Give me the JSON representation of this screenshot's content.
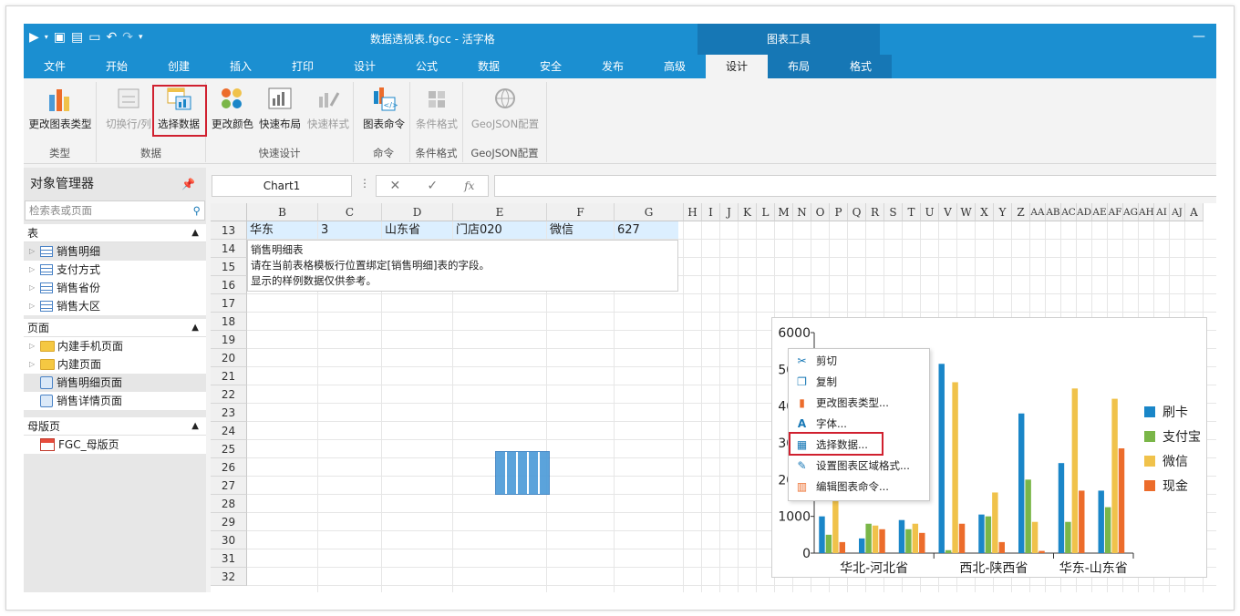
{
  "window": {
    "title": "数据透视表.fgcc - 活字格",
    "context_group": "图表工具"
  },
  "tabs": [
    "文件",
    "开始",
    "创建",
    "插入",
    "打印",
    "设计",
    "公式",
    "数据",
    "安全",
    "发布",
    "高级",
    "设计",
    "布局",
    "格式"
  ],
  "ribbon": {
    "groups": [
      {
        "label": "类型",
        "buttons": [
          "更改图表类型"
        ]
      },
      {
        "label": "数据",
        "buttons": [
          "切换行/列",
          "选择数据"
        ]
      },
      {
        "label": "快速设计",
        "buttons": [
          "更改颜色",
          "快速布局",
          "快速样式"
        ]
      },
      {
        "label": "命令",
        "buttons": [
          "图表命令"
        ]
      },
      {
        "label": "条件格式",
        "buttons": [
          "条件格式"
        ]
      },
      {
        "label": "GeoJSON配置",
        "buttons": [
          "GeoJSON配置"
        ]
      }
    ]
  },
  "panel": {
    "title": "对象管理器",
    "search_placeholder": "检索表或页面",
    "sections": [
      {
        "title": "表",
        "items": [
          "销售明细",
          "支付方式",
          "销售省份",
          "销售大区"
        ]
      },
      {
        "title": "页面",
        "items": [
          "内建手机页面",
          "内建页面",
          "销售明细页面",
          "销售详情页面"
        ]
      },
      {
        "title": "母版页",
        "items": [
          "FGC_母版页"
        ]
      }
    ]
  },
  "formula_bar": {
    "name_box": "Chart1",
    "fx": "fx"
  },
  "sheet": {
    "columns": [
      "B",
      "C",
      "D",
      "E",
      "F",
      "G",
      "H",
      "I",
      "J",
      "K",
      "L",
      "M",
      "N",
      "O",
      "P",
      "Q",
      "R",
      "S",
      "T",
      "U",
      "V",
      "W",
      "X",
      "Y",
      "Z",
      "AA",
      "AB",
      "AC",
      "AD",
      "AE",
      "AF",
      "AG",
      "AH",
      "AI",
      "AJ",
      "A"
    ],
    "rows": [
      "13",
      "14",
      "15",
      "16",
      "17",
      "18",
      "19",
      "20",
      "21",
      "22",
      "23",
      "24",
      "25",
      "26",
      "27",
      "28",
      "29",
      "30",
      "31",
      "32"
    ],
    "row13": [
      "华东",
      "3",
      "山东省",
      "门店020",
      "微信",
      "627"
    ],
    "notes": [
      "销售明细表",
      "请在当前表格模板行位置绑定[销售明细]表的字段。",
      "显示的样例数据仅供参考。"
    ]
  },
  "context_menu": [
    "剪切",
    "复制",
    "更改图表类型...",
    "字体...",
    "选择数据...",
    "设置图表区域格式...",
    "编辑图表命令..."
  ],
  "chart_data": {
    "type": "bar",
    "categories": [
      "华北-河北省",
      "西北-陕西省",
      "华东-山东省"
    ],
    "ylim": [
      0,
      6000
    ],
    "yticks": [
      "0",
      "1000",
      "2000",
      "3000",
      "4000",
      "5000",
      "6000"
    ],
    "series": [
      {
        "name": "刷卡",
        "color": "#1a86c8",
        "values": [
          1000,
          400,
          900,
          5150,
          1050,
          3800,
          2450,
          1700
        ]
      },
      {
        "name": "支付宝",
        "color": "#7ab648",
        "values": [
          500,
          800,
          650,
          80,
          1000,
          2000,
          850,
          1250
        ]
      },
      {
        "name": "微信",
        "color": "#f0c24b",
        "values": [
          2000,
          750,
          800,
          4650,
          1650,
          850,
          4480,
          4200
        ]
      },
      {
        "name": "现金",
        "color": "#ec6c2b",
        "values": [
          300,
          650,
          550,
          800,
          300,
          60,
          1700,
          2850
        ]
      }
    ],
    "groups_per_category": [
      3,
      3,
      2
    ],
    "legend": "right"
  }
}
